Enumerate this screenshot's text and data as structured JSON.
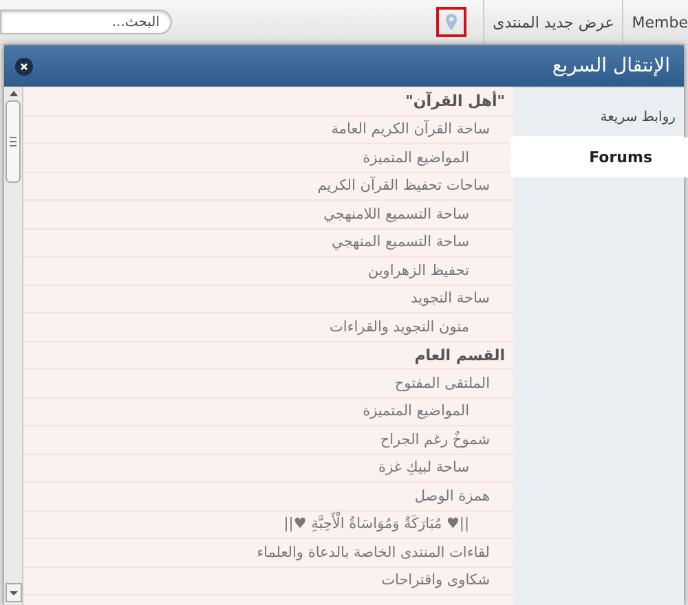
{
  "topbar": {
    "search": {
      "placeholder": "البحث..."
    },
    "nav": [
      "Membe",
      "عرض جديد المنتدى"
    ]
  },
  "dialog": {
    "title": "الإنتقال السريع",
    "tabs": [
      {
        "label": "روابط سريعة",
        "selected": false
      },
      {
        "label": "Forums",
        "selected": true
      }
    ],
    "forums": [
      {
        "label": "\"أهل القرآن\"",
        "children": [
          {
            "label": "ساحة القرآن الكريم العامة",
            "children": [
              {
                "label": "المواضيع المتميزة"
              }
            ]
          },
          {
            "label": "ساحات تحفيظ القرآن الكريم",
            "children": [
              {
                "label": "ساحة التسميع اللامنهجي"
              },
              {
                "label": "ساحة التسميع المنهجي"
              },
              {
                "label": "تحفيظ الزهراوين"
              }
            ]
          },
          {
            "label": "ساحة التجويد",
            "children": [
              {
                "label": "متون التجويد والقراءات"
              }
            ]
          }
        ]
      },
      {
        "label": "القسم العام",
        "children": [
          {
            "label": "الملتقى المفتوح",
            "children": [
              {
                "label": "المواضيع المتميزة"
              }
            ]
          },
          {
            "label": "شموخٌ رغم الجراح",
            "children": [
              {
                "label": "ساحة لبيكِ غزة"
              }
            ]
          },
          {
            "label": "همزة الوصل",
            "children": [
              {
                "label": "||♥ مُبَارَكَةٌ وَمُوَاسَاةُ الْأَحِبَّةِ ♥||"
              }
            ]
          },
          {
            "label": "لقاءات المنتدى الخاصة بالدعاة والعلماء"
          },
          {
            "label": "شكاوى واقتراحات"
          }
        ]
      }
    ]
  }
}
